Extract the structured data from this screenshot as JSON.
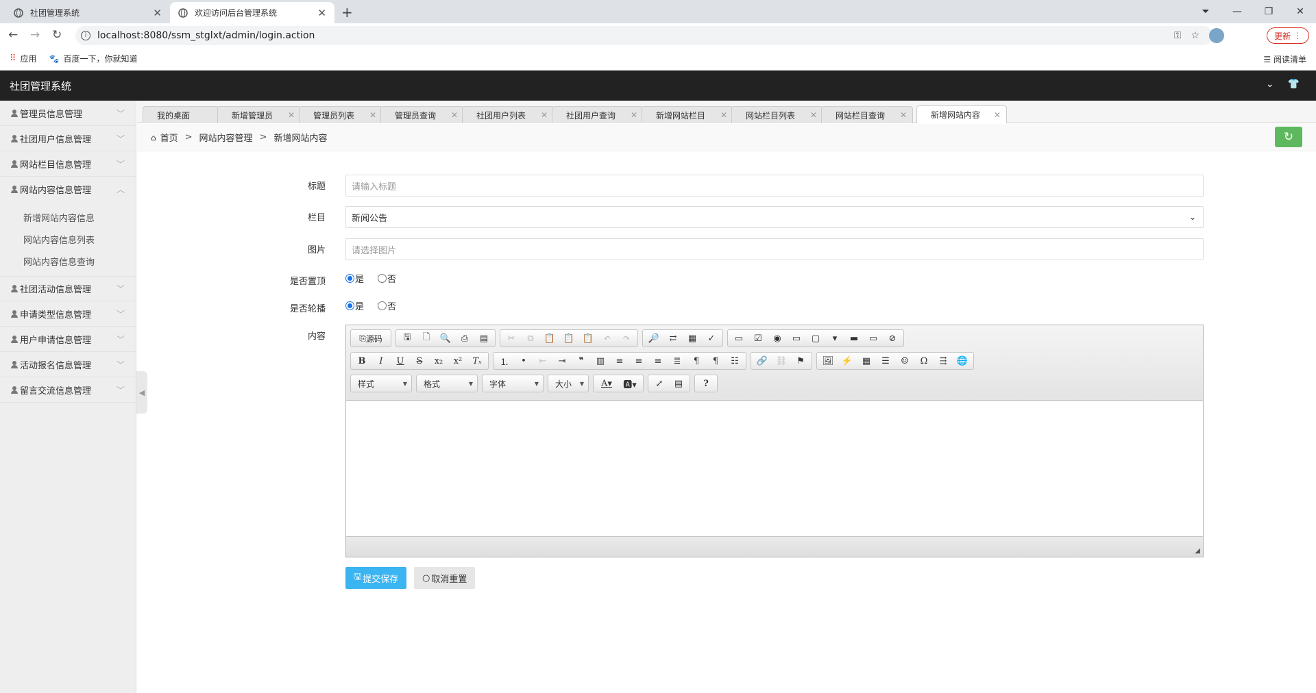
{
  "browser": {
    "tabs": [
      {
        "title": "社团管理系统"
      },
      {
        "title": "欢迎访问后台管理系统"
      }
    ],
    "url": "localhost:8080/ssm_stglxt/admin/login.action",
    "update_label": "更新",
    "bookmarks": [
      {
        "label": "应用",
        "icon": "apps-grid-icon"
      },
      {
        "label": "百度一下，你就知道",
        "icon": "baidu-paw-icon"
      }
    ],
    "reading_list": "阅读清单"
  },
  "app": {
    "title": "社团管理系统"
  },
  "sidebar": {
    "items": [
      {
        "label": "管理员信息管理",
        "expanded": false
      },
      {
        "label": "社团用户信息管理",
        "expanded": false
      },
      {
        "label": "网站栏目信息管理",
        "expanded": false
      },
      {
        "label": "网站内容信息管理",
        "expanded": true
      },
      {
        "label": "社团活动信息管理",
        "expanded": false
      },
      {
        "label": "申请类型信息管理",
        "expanded": false
      },
      {
        "label": "用户申请信息管理",
        "expanded": false
      },
      {
        "label": "活动报名信息管理",
        "expanded": false
      },
      {
        "label": "留言交流信息管理",
        "expanded": false
      }
    ],
    "subitems": [
      "新增网站内容信息",
      "网站内容信息列表",
      "网站内容信息查询"
    ]
  },
  "page_tabs": [
    {
      "label": "我的桌面",
      "closable": false
    },
    {
      "label": "新增管理员",
      "closable": true
    },
    {
      "label": "管理员列表",
      "closable": true
    },
    {
      "label": "管理员查询",
      "closable": true
    },
    {
      "label": "社团用户列表",
      "closable": true
    },
    {
      "label": "社团用户查询",
      "closable": true
    },
    {
      "label": "新增网站栏目",
      "closable": true
    },
    {
      "label": "网站栏目列表",
      "closable": true
    },
    {
      "label": "网站栏目查询",
      "closable": true
    },
    {
      "label": "新增网站内容",
      "closable": true,
      "active": true
    }
  ],
  "breadcrumb": [
    "首页",
    "网站内容管理",
    "新增网站内容"
  ],
  "form": {
    "title_label": "标题",
    "title_placeholder": "请输入标题",
    "column_label": "栏目",
    "column_value": "新闻公告",
    "image_label": "图片",
    "image_placeholder": "请选择图片",
    "top_label": "是否置顶",
    "carousel_label": "是否轮播",
    "yes": "是",
    "no": "否",
    "top_value": "是",
    "carousel_value": "是",
    "content_label": "内容"
  },
  "editor": {
    "source_label": "源码",
    "combos": [
      "样式",
      "格式",
      "字体",
      "大小"
    ]
  },
  "buttons": {
    "submit": "提交保存",
    "reset": "取消重置"
  },
  "colors": {
    "header_bg": "#222222",
    "submit_bg": "#3bb4f2",
    "refresh_bg": "#5eb95e"
  }
}
